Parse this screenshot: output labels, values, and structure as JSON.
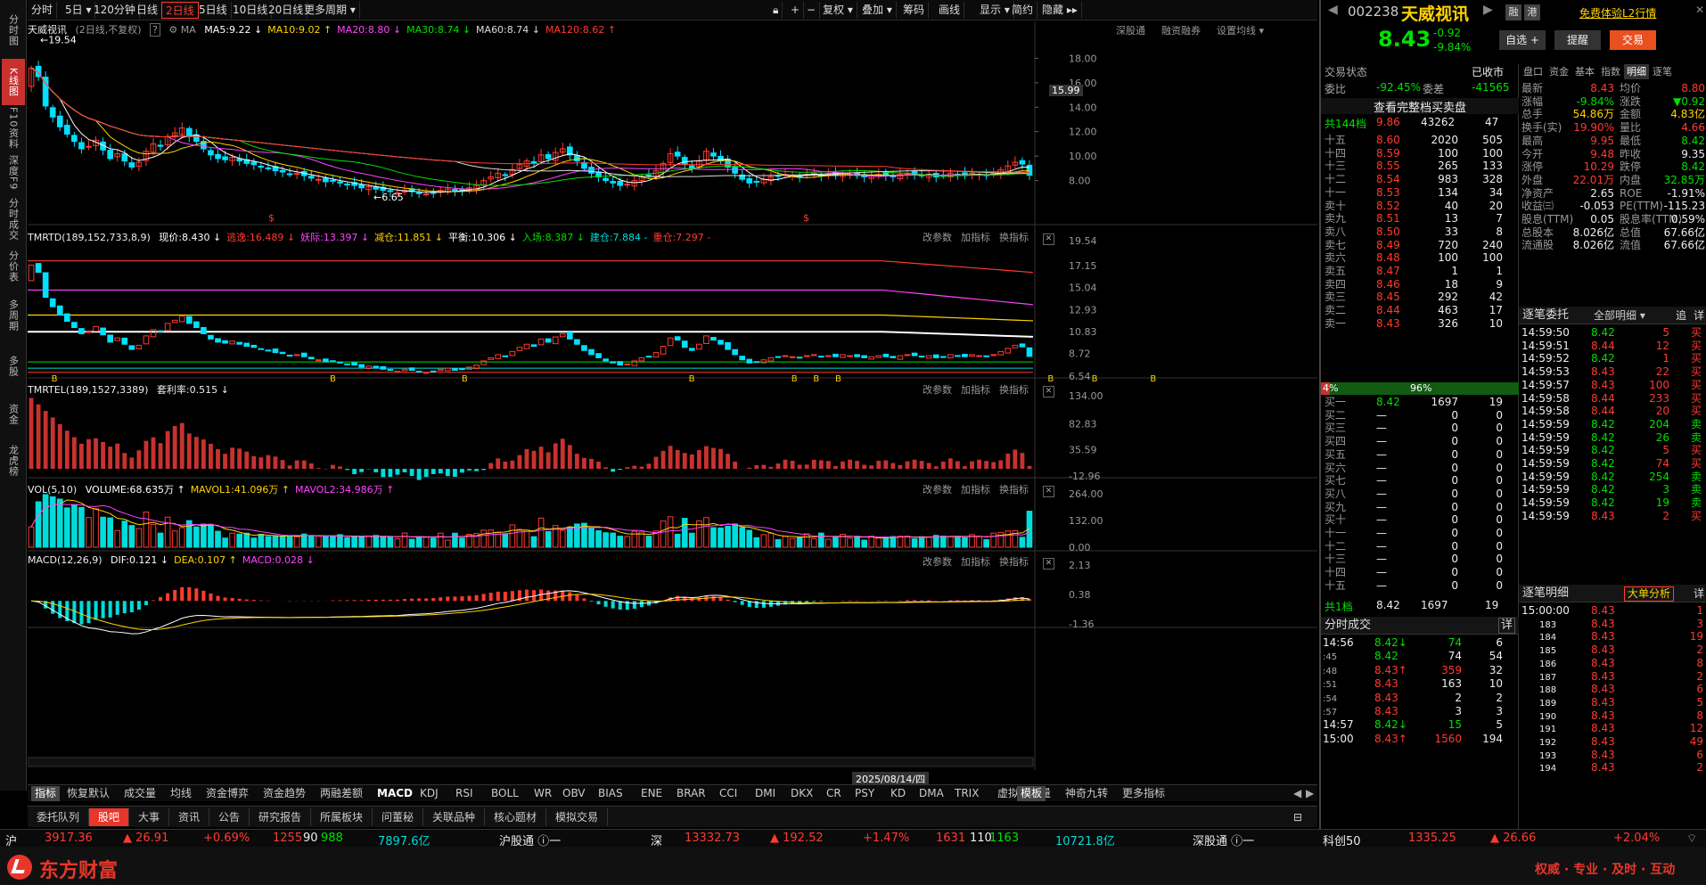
{
  "left_nav": [
    "分时图",
    "K线图",
    "F10资料",
    "深度F9",
    "分时成交",
    "分价表",
    "多周期",
    "多股",
    "资金",
    "龙虎榜"
  ],
  "period_tabs": [
    "分时",
    "5日 ▾",
    "120分钟",
    "日线",
    "2日线",
    "5日线",
    "10日线",
    "20日线",
    "更多周期 ▾"
  ],
  "toolbar_right": [
    "复权 ▾",
    "叠加 ▾",
    "筹码",
    "画线",
    "显示 ▾",
    "简约",
    "隐藏 ▸▸"
  ],
  "stock": {
    "name": "天威视讯",
    "period_label": "(2日线,不复权)",
    "code": "002238",
    "price": "8.43",
    "change": "-0.92",
    "pct": "-9.84%"
  },
  "ma_line": [
    {
      "t": "MA5:9.22 ↓",
      "c": "#ffffff"
    },
    {
      "t": "MA10:9.02 ↑",
      "c": "#ffd400"
    },
    {
      "t": "MA20:8.80 ↓",
      "c": "#ff44ff"
    },
    {
      "t": "MA30:8.74 ↓",
      "c": "#00e000"
    },
    {
      "t": "MA60:8.74 ↓",
      "c": "#dddddd"
    },
    {
      "t": "MA120:8.62 ↑",
      "c": "#ff3b30"
    }
  ],
  "chart_links": [
    "深股通",
    "融资融券",
    "设置均线 ▾"
  ],
  "price_annot": {
    "high": "←19.54",
    "low": "←6.65"
  },
  "price_axis": [
    "18.00",
    "16.00",
    "14.00",
    "12.00",
    "10.00",
    "8.00"
  ],
  "price_cursor": "15.99",
  "tmrtd": {
    "label": "TMRTD(189,152,733,8,9)",
    "items": [
      {
        "t": "现价:8.430 ↓",
        "c": "#ffffff"
      },
      {
        "t": "逃逸:16.489 ↓",
        "c": "#ff3b30"
      },
      {
        "t": "妖际:13.397 ↓",
        "c": "#ff44ff"
      },
      {
        "t": "减仓:11.851 ↓",
        "c": "#ffd400"
      },
      {
        "t": "平衡:10.306 ↓",
        "c": "#ffffff"
      },
      {
        "t": "入场:8.387 ↓",
        "c": "#00e000"
      },
      {
        "t": "建仓:7.884 -",
        "c": "#00dcdc"
      },
      {
        "t": "重仓:7.297 -",
        "c": "#ff3b30"
      }
    ],
    "axis": [
      "19.54",
      "17.15",
      "15.04",
      "12.93",
      "10.83",
      "8.72",
      "6.54"
    ]
  },
  "tmrtel": {
    "label": "TMRTEL(189,1527,3389)",
    "item": "套利率:0.515 ↓",
    "axis": [
      "134.00",
      "82.83",
      "35.59",
      "-12.96"
    ]
  },
  "vol": {
    "label": "VOL(5,10)",
    "items": [
      {
        "t": "VOLUME:68.635万 ↑",
        "c": "#ffffff"
      },
      {
        "t": "MAVOL1:41.096万 ↑",
        "c": "#ffd400"
      },
      {
        "t": "MAVOL2:34.986万 ↑",
        "c": "#ff44ff"
      }
    ],
    "axis": [
      "264.00",
      "132.00",
      "0.00"
    ]
  },
  "macd": {
    "label": "MACD(12,26,9)",
    "items": [
      {
        "t": "DIF:0.121 ↓",
        "c": "#ffffff"
      },
      {
        "t": "DEA:0.107 ↑",
        "c": "#ffd400"
      },
      {
        "t": "MACD:0.028 ↓",
        "c": "#ff44ff"
      }
    ],
    "axis": [
      "2.13",
      "0.38",
      "-1.36"
    ]
  },
  "panel_tools": [
    "改参数",
    "加指标",
    "换指标"
  ],
  "date_cursor": "2025/08/14/四",
  "indicator_tabs": [
    "指标",
    "恢复默认",
    "成交量",
    "均线",
    "资金博弈",
    "资金趋势",
    "两融差额",
    "MACD",
    "KDJ",
    "RSI",
    "BOLL",
    "WR",
    "OBV",
    "BIAS",
    "ENE",
    "BRAR",
    "CCI",
    "DMI",
    "DKX",
    "CR",
    "PSY",
    "KD",
    "DMA",
    "TRIX",
    "虚拟成交量",
    "神奇九转",
    "更多指标",
    "模板"
  ],
  "news_tabs": [
    "委托队列",
    "股吧",
    "大事",
    "资讯",
    "公告",
    "研究报告",
    "所属板块",
    "问董秘",
    "关联品种",
    "核心题材",
    "模拟交易"
  ],
  "right": {
    "free_trial": "免费体验L2行情",
    "badges": [
      "融",
      "港"
    ],
    "buttons": [
      "自选 +",
      "提醒",
      "交易"
    ],
    "trade_status": "交易状态",
    "trade_status_val": "已收市",
    "weibi": "委比",
    "weibi_val": "-92.45%",
    "weicha": "委差",
    "weicha_val": "-41565",
    "full_queue": "查看完整档买卖盘",
    "total144": "共144档",
    "total144_price": "9.86",
    "total144_vol": "43262",
    "total144_n": "47",
    "sells": [
      [
        "十五",
        "8.60",
        "2020",
        "505"
      ],
      [
        "十四",
        "8.59",
        "100",
        "100"
      ],
      [
        "十三",
        "8.55",
        "265",
        "133"
      ],
      [
        "十二",
        "8.54",
        "983",
        "328"
      ],
      [
        "十一",
        "8.53",
        "134",
        "34"
      ],
      [
        "卖十",
        "8.52",
        "40",
        "20"
      ],
      [
        "卖九",
        "8.51",
        "13",
        "7"
      ],
      [
        "卖八",
        "8.50",
        "33",
        "8"
      ],
      [
        "卖七",
        "8.49",
        "720",
        "240"
      ],
      [
        "卖六",
        "8.48",
        "100",
        "100"
      ],
      [
        "卖五",
        "8.47",
        "1",
        "1"
      ],
      [
        "卖四",
        "8.46",
        "18",
        "9"
      ],
      [
        "卖三",
        "8.45",
        "292",
        "42"
      ],
      [
        "卖二",
        "8.44",
        "463",
        "17"
      ],
      [
        "卖一",
        "8.43",
        "326",
        "10"
      ]
    ],
    "bar_left": "4%",
    "bar_right": "96%",
    "buys": [
      [
        "买一",
        "8.42",
        "1697",
        "19"
      ],
      [
        "买二",
        "—",
        "0",
        "0"
      ],
      [
        "买三",
        "—",
        "0",
        "0"
      ],
      [
        "买四",
        "—",
        "0",
        "0"
      ],
      [
        "买五",
        "—",
        "0",
        "0"
      ],
      [
        "买六",
        "—",
        "0",
        "0"
      ],
      [
        "买七",
        "—",
        "0",
        "0"
      ],
      [
        "买八",
        "—",
        "0",
        "0"
      ],
      [
        "买九",
        "—",
        "0",
        "0"
      ],
      [
        "买十",
        "—",
        "0",
        "0"
      ],
      [
        "十一",
        "—",
        "0",
        "0"
      ],
      [
        "十二",
        "—",
        "0",
        "0"
      ],
      [
        "十三",
        "—",
        "0",
        "0"
      ],
      [
        "十四",
        "—",
        "0",
        "0"
      ],
      [
        "十五",
        "—",
        "0",
        "0"
      ]
    ],
    "total1": "共1档",
    "total1_price": "8.42",
    "total1_vol": "1697",
    "total1_n": "19",
    "tick_title": "分时成交",
    "tick_detail": "详",
    "ticks": [
      [
        "14:56",
        "8.42↓",
        "74",
        "6"
      ],
      [
        ":45",
        "8.42",
        "74",
        "54"
      ],
      [
        ":48",
        "8.43↑",
        "359",
        "32"
      ],
      [
        ":51",
        "8.43",
        "163",
        "10"
      ],
      [
        ":54",
        "8.43",
        "2",
        "2"
      ],
      [
        ":57",
        "8.43",
        "3",
        "3"
      ],
      [
        "14:57",
        "8.42↓",
        "15",
        "5"
      ],
      [
        "15:00",
        "8.43↑",
        "1560",
        "194"
      ]
    ],
    "tabs": [
      "盘口",
      "资金",
      "基本",
      "指数",
      "明细",
      "逐笔"
    ],
    "quote": [
      [
        "最新",
        "8.43",
        "均价",
        "8.80"
      ],
      [
        "涨幅",
        "-9.84%",
        "涨跌",
        "▼0.92"
      ],
      [
        "总手",
        "54.86万",
        "金额",
        "4.83亿"
      ],
      [
        "换手(实)",
        "19.90%",
        "量比",
        "4.66"
      ],
      [
        "最高",
        "9.95",
        "最低",
        "8.42"
      ],
      [
        "今开",
        "9.48",
        "昨收",
        "9.35"
      ],
      [
        "涨停",
        "10.29",
        "跌停",
        "8.42"
      ],
      [
        "外盘",
        "22.01万",
        "内盘",
        "32.85万"
      ],
      [
        "净资产",
        "2.65",
        "ROE",
        "-1.91%"
      ],
      [
        "收益㈢",
        "-0.053",
        "PE(TTM)",
        "-115.23"
      ],
      [
        "股息(TTM)",
        "0.05",
        "股息率(TTM)",
        "0.59%"
      ],
      [
        "总股本",
        "8.026亿",
        "总值",
        "67.66亿"
      ],
      [
        "流通股",
        "8.026亿",
        "流值",
        "67.66亿"
      ]
    ],
    "orders_title": "逐笔委托",
    "orders_filter": "全部明细 ▾",
    "orders_actions": [
      "追",
      "详"
    ],
    "orders": [
      [
        "14:59:50",
        "8.42",
        "5",
        "买"
      ],
      [
        "14:59:51",
        "8.44",
        "12",
        "买"
      ],
      [
        "14:59:52",
        "8.42",
        "1",
        "买"
      ],
      [
        "14:59:53",
        "8.43",
        "22",
        "买"
      ],
      [
        "14:59:57",
        "8.43",
        "100",
        "买"
      ],
      [
        "14:59:58",
        "8.44",
        "233",
        "买"
      ],
      [
        "14:59:58",
        "8.44",
        "20",
        "买"
      ],
      [
        "14:59:59",
        "8.42",
        "204",
        "卖"
      ],
      [
        "14:59:59",
        "8.42",
        "26",
        "卖"
      ],
      [
        "14:59:59",
        "8.42",
        "5",
        "买"
      ],
      [
        "14:59:59",
        "8.42",
        "74",
        "买"
      ],
      [
        "14:59:59",
        "8.42",
        "254",
        "卖"
      ],
      [
        "14:59:59",
        "8.42",
        "3",
        "卖"
      ],
      [
        "14:59:59",
        "8.42",
        "19",
        "卖"
      ],
      [
        "14:59:59",
        "8.43",
        "2",
        "买"
      ]
    ],
    "detail_title": "逐笔明细",
    "detail_btn": "大单分析",
    "detail_act": "详",
    "details": [
      [
        "15:00:00",
        "8.43",
        "1"
      ],
      [
        "183",
        "8.43",
        "3"
      ],
      [
        "184",
        "8.43",
        "19"
      ],
      [
        "185",
        "8.43",
        "2"
      ],
      [
        "186",
        "8.43",
        "8"
      ],
      [
        "187",
        "8.43",
        "2"
      ],
      [
        "188",
        "8.43",
        "6"
      ],
      [
        "189",
        "8.43",
        "5"
      ],
      [
        "190",
        "8.43",
        "8"
      ],
      [
        "191",
        "8.43",
        "12"
      ],
      [
        "192",
        "8.43",
        "49"
      ],
      [
        "193",
        "8.43",
        "6"
      ],
      [
        "194",
        "8.43",
        "2"
      ]
    ]
  },
  "status_bar": {
    "sh": "沪",
    "sh_idx": "3917.36",
    "sh_chg": "▲ 26.91",
    "sh_pct": "+0.69%",
    "sh_up": "1255",
    "sh_flat": "90",
    "sh_dn": "988",
    "sh_amt": "7897.6亿",
    "sh_conn": "沪股通 ⓘ一",
    "sz": "深",
    "sz_idx": "13332.73",
    "sz_chg": "▲ 192.52",
    "sz_pct": "+1.47%",
    "sz_up": "1631",
    "sz_flat": "110",
    "sz_dn": "1163",
    "sz_amt": "10721.8亿",
    "sz_conn": "深股通 ⓘ一",
    "kc": "科创50",
    "kc_idx": "1335.25",
    "kc_chg": "▲ 26.66",
    "kc_pct": "+2.04%"
  },
  "footer": {
    "brand": "东方财富",
    "slogan": "权威 · 专业 · 及时 · 互动"
  },
  "chart_data": {
    "type": "candlestick",
    "title": "天威视讯 (2日线,不复权)",
    "ylim": [
      6.0,
      20.0
    ],
    "x": "2-day bars",
    "close": [
      17.2,
      16.5,
      14.1,
      13.2,
      12.4,
      11.8,
      11.2,
      10.6,
      10.8,
      11.3,
      10.5,
      9.8,
      10.2,
      9.6,
      9.1,
      9.5,
      10.4,
      11.0,
      10.8,
      11.6,
      11.9,
      12.3,
      11.6,
      11.2,
      10.6,
      10.1,
      9.8,
      9.7,
      9.9,
      9.6,
      9.4,
      9.3,
      9.1,
      9.0,
      8.8,
      8.7,
      8.5,
      8.6,
      8.4,
      8.2,
      8.1,
      7.9,
      8.0,
      7.8,
      7.7,
      7.6,
      7.4,
      7.5,
      7.3,
      7.2,
      7.1,
      7.0,
      7.2,
      7.1,
      7.0,
      6.9,
      7.0,
      7.2,
      7.3,
      7.1,
      7.2,
      7.4,
      7.6,
      8.0,
      8.3,
      8.6,
      8.4,
      8.9,
      9.3,
      9.6,
      9.4,
      10.1,
      9.8,
      10.3,
      10.6,
      10.1,
      9.6,
      9.0,
      8.6,
      8.3,
      8.0,
      7.8,
      7.6,
      7.7,
      8.0,
      8.3,
      8.4,
      8.8,
      9.4,
      10.2,
      10.0,
      9.3,
      9.0,
      9.6,
      10.4,
      10.0,
      9.6,
      9.1,
      8.6,
      8.1,
      7.8,
      7.9,
      8.1,
      8.3,
      8.4,
      8.5,
      8.4,
      8.3,
      8.5,
      8.6,
      8.4,
      8.5,
      8.4,
      8.6,
      8.5,
      8.4,
      8.3,
      8.4,
      8.5,
      8.4,
      8.3,
      8.5,
      8.6,
      8.5,
      8.4,
      8.5,
      8.3,
      8.4,
      8.6,
      8.5,
      8.4,
      8.6,
      8.5,
      8.4,
      8.6,
      8.9,
      9.2,
      9.5,
      9.35,
      8.43
    ]
  }
}
